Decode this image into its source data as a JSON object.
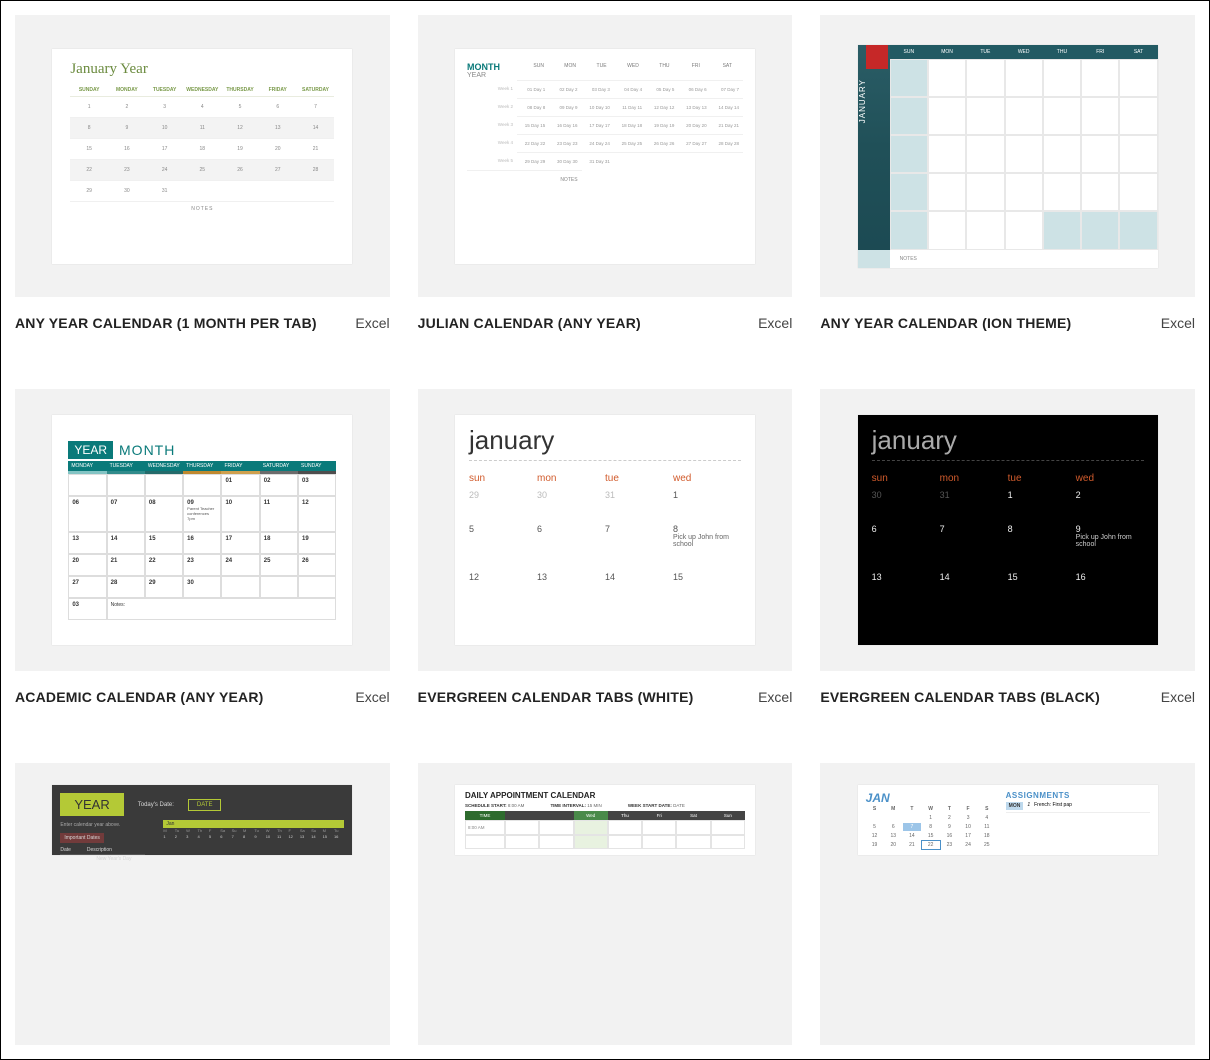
{
  "templates": [
    {
      "title": "ANY YEAR CALENDAR (1 MONTH PER TAB)",
      "app": "Excel"
    },
    {
      "title": "JULIAN CALENDAR (ANY YEAR)",
      "app": "Excel"
    },
    {
      "title": "ANY YEAR CALENDAR (ION THEME)",
      "app": "Excel"
    },
    {
      "title": "ACADEMIC CALENDAR (ANY YEAR)",
      "app": "Excel"
    },
    {
      "title": "EVERGREEN CALENDAR TABS (WHITE)",
      "app": "Excel"
    },
    {
      "title": "EVERGREEN CALENDAR TABS (BLACK)",
      "app": "Excel"
    },
    {
      "title": "",
      "app": ""
    },
    {
      "title": "",
      "app": ""
    },
    {
      "title": "",
      "app": ""
    }
  ],
  "t1": {
    "title": "January Year",
    "days": [
      "SUNDAY",
      "MONDAY",
      "TUESDAY",
      "WEDNESDAY",
      "THURSDAY",
      "FRIDAY",
      "SATURDAY"
    ],
    "rows": [
      [
        "1",
        "2",
        "3",
        "4",
        "5",
        "6",
        "7"
      ],
      [
        "8",
        "9",
        "10",
        "11",
        "12",
        "13",
        "14"
      ],
      [
        "15",
        "16",
        "17",
        "18",
        "19",
        "20",
        "21"
      ],
      [
        "22",
        "23",
        "24",
        "25",
        "26",
        "27",
        "28"
      ],
      [
        "29",
        "30",
        "31",
        "",
        "",
        "",
        ""
      ]
    ],
    "notes": "NOTES"
  },
  "t2": {
    "month": "MONTH",
    "year": "YEAR",
    "days": [
      "SUN",
      "MON",
      "TUE",
      "WED",
      "THU",
      "FRI",
      "SAT"
    ],
    "rows": [
      {
        "wk": "Week 1",
        "cells": [
          "01 Day 1",
          "02 Day 2",
          "03 Day 3",
          "04 Day 4",
          "05 Day 5",
          "06 Day 6",
          "07 Day 7"
        ]
      },
      {
        "wk": "Week 2",
        "cells": [
          "08 Day 8",
          "09 Day 9",
          "10 Day 10",
          "11 Day 11",
          "12 Day 12",
          "13 Day 13",
          "14 Day 14"
        ]
      },
      {
        "wk": "Week 3",
        "cells": [
          "15 Day 15",
          "16 Day 16",
          "17 Day 17",
          "18 Day 18",
          "19 Day 19",
          "20 Day 20",
          "21 Day 21"
        ]
      },
      {
        "wk": "Week 4",
        "cells": [
          "22 Day 22",
          "23 Day 23",
          "24 Day 24",
          "25 Day 25",
          "26 Day 26",
          "27 Day 27",
          "28 Day 28"
        ]
      },
      {
        "wk": "Week 5",
        "cells": [
          "29 Day 29",
          "30 Day 30",
          "31 Day 31",
          "",
          "",
          "",
          ""
        ]
      }
    ],
    "notes": "NOTES"
  },
  "t3": {
    "month": "JANUARY",
    "days": [
      "SUN",
      "MON",
      "TUE",
      "WED",
      "THU",
      "FRI",
      "SAT"
    ],
    "notes": "NOTES"
  },
  "t4": {
    "year": "YEAR",
    "month": "MONTH",
    "days": [
      "MONDAY",
      "TUESDAY",
      "WEDNESDAY",
      "THURSDAY",
      "FRIDAY",
      "SATURDAY",
      "SUNDAY"
    ],
    "rows": [
      [
        "",
        "",
        "",
        "",
        "01",
        "02",
        "03"
      ],
      [
        "06",
        "07",
        "08",
        "09",
        "10",
        "11",
        "12"
      ],
      [
        "13",
        "14",
        "15",
        "16",
        "17",
        "18",
        "19"
      ],
      [
        "20",
        "21",
        "22",
        "23",
        "24",
        "25",
        "26"
      ],
      [
        "27",
        "28",
        "29",
        "30",
        "",
        "",
        ""
      ],
      [
        "03",
        "",
        "",
        "",
        "",
        "",
        ""
      ]
    ],
    "event": "Parent Teacher conferences 7pm",
    "notes": "Notes:"
  },
  "t5": {
    "title": "january",
    "days": [
      "sun",
      "mon",
      "tue",
      "wed"
    ],
    "rows": [
      [
        "29",
        "30",
        "31",
        "1"
      ],
      [
        "5",
        "6",
        "7",
        "8"
      ],
      [
        "12",
        "13",
        "14",
        "15"
      ]
    ],
    "note": "Pick up John from school"
  },
  "t6": {
    "title": "january",
    "days": [
      "sun",
      "mon",
      "tue",
      "wed"
    ],
    "rows": [
      [
        "30",
        "31",
        "1",
        "2"
      ],
      [
        "6",
        "7",
        "8",
        "9"
      ],
      [
        "13",
        "14",
        "15",
        "16"
      ]
    ],
    "note": "Pick up John from school"
  },
  "t7": {
    "year": "YEAR",
    "todays": "Today's Date:",
    "date_btn": "DATE",
    "enter_label": "Enter calendar year above.",
    "important": "Important Dates",
    "col_date": "Date",
    "col_desc": "Description",
    "jan": "Jan",
    "new_years": "New Year's Day",
    "mini_days": [
      "M",
      "Tu",
      "W",
      "Th",
      "F",
      "Sa",
      "Su",
      "M",
      "Tu",
      "W",
      "Th",
      "F",
      "Sa",
      "Su",
      "M",
      "Tu"
    ]
  },
  "t8": {
    "title": "DAILY APPOINTMENT CALENDAR",
    "schedule_start_lbl": "SCHEDULE START:",
    "schedule_start_val": "8:00 AM",
    "time_interval_lbl": "TIME INTERVAL:",
    "time_interval_val": "15 MIN",
    "week_start_lbl": "WEEK START DATE:",
    "week_start_val": "DATE",
    "cols": [
      "TIME",
      "Wed",
      "Thu",
      "Fri",
      "Sat",
      "Sun"
    ],
    "first_time": "8:00 AM"
  },
  "t9": {
    "jan": "JAN",
    "days": [
      "S",
      "M",
      "T",
      "W",
      "T",
      "F",
      "S"
    ],
    "rows": [
      [
        "",
        "",
        "",
        "1",
        "2",
        "3",
        "4"
      ],
      [
        "5",
        "6",
        "7",
        "8",
        "9",
        "10",
        "11"
      ],
      [
        "12",
        "13",
        "14",
        "15",
        "16",
        "17",
        "18"
      ],
      [
        "19",
        "20",
        "21",
        "22",
        "23",
        "24",
        "25"
      ]
    ],
    "assignments": "ASSIGNMENTS",
    "mon": "MON",
    "item_num": "1",
    "item_txt": "French: First pap"
  }
}
